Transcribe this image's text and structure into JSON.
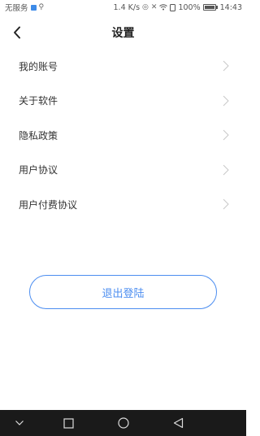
{
  "status_bar": {
    "carrier": "无服务",
    "speed": "1.4 K/s",
    "battery_percent": "100%",
    "time": "14:43"
  },
  "header": {
    "title": "设置",
    "back_icon": "chevron-left-icon"
  },
  "menu": {
    "items": [
      {
        "label": "我的账号"
      },
      {
        "label": "关于软件"
      },
      {
        "label": "隐私政策"
      },
      {
        "label": "用户协议"
      },
      {
        "label": "用户付费协议"
      }
    ],
    "chevron_icon": "chevron-right-icon"
  },
  "logout": {
    "label": "退出登陆"
  },
  "nav_bar": {
    "icons": [
      "chevron-down-icon",
      "square-icon",
      "circle-icon",
      "triangle-back-icon"
    ]
  },
  "colors": {
    "accent": "#4b8df0",
    "nav_background": "#1a1a1a"
  }
}
